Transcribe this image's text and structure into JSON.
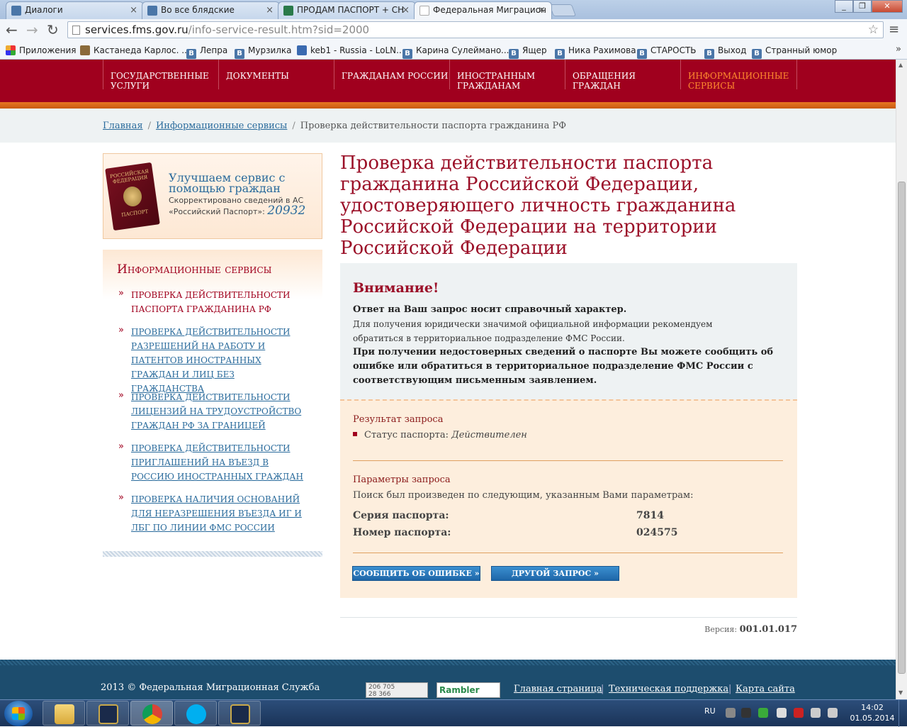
{
  "tabs": [
    {
      "label": "Диалоги",
      "color": "#4a76a8"
    },
    {
      "label": "Во все блядские",
      "color": "#4a76a8"
    },
    {
      "label": "ПРОДАМ ПАСПОРТ + СН",
      "color": "#2a7a4a"
    },
    {
      "label": "Федеральная Миграцион",
      "color": "#ffffff"
    }
  ],
  "address": {
    "host": "services.fms.gov.ru",
    "path": "/info-service-result.htm?sid=2000"
  },
  "bookmarks": [
    "Приложения",
    "Кастанеда Карлос. ...",
    "Лепра",
    "Мурзилка",
    "keb1 - Russia - LoLN...",
    "Карина Сулейманo...",
    "Ящер",
    "Ника Рахимова",
    "СТАРОСТЬ",
    "Выход",
    "Странный юмор"
  ],
  "nav": [
    {
      "label": "ГОСУДАРСТВЕННЫЕ\nУСЛУГИ"
    },
    {
      "label": "ДОКУМЕНТЫ"
    },
    {
      "label": "ГРАЖДАНАМ РОССИИ"
    },
    {
      "label": "ИНОСТРАННЫМ\nГРАЖДАНАМ"
    },
    {
      "label": "ОБРАЩЕНИЯ\nГРАЖДАН"
    },
    {
      "label": "ИНФОРМАЦИОННЫЕ\nСЕРВИСЫ"
    }
  ],
  "breadcrumbs": {
    "home": "Главная",
    "section": "Информационные сервисы",
    "current": "Проверка действительности паспорта гражданина РФ"
  },
  "promo": {
    "title": "Улучшаем сервис с помощью граждан",
    "text": "Скорректировано сведений в АС «Российский Паспорт»:",
    "count": "20932",
    "passport_top": "РОССИЙСКАЯ ФЕДЕРАЦИЯ",
    "passport_label": "ПАСПОРТ"
  },
  "sidebar": {
    "title": "Информационные сервисы",
    "items": [
      "Проверка действительности паспорта гражданина РФ",
      "Проверка действительности разрешений на работу и патентов иностранных граждан и лиц без гражданства",
      "Проверка действительности лицензий на трудоустройство граждан РФ за границей",
      "Проверка действительности приглашений на въезд в Россию иностранных граждан",
      "Проверка наличия оснований для неразрешения въезда ИГ и ЛБГ по линии ФМС России"
    ]
  },
  "page_title": "Проверка действительности паспорта гражданина Российской Федерации, удостоверяющего личность гражданина Российской Федерации на территории Российской Федерации",
  "attention": {
    "heading": "Внимание!",
    "p1": "Ответ на Ваш запрос носит справочный характер.",
    "p2": "Для получения юридически значимой официальной информации рекомендуем обратиться в территориальное подразделение ФМС России.",
    "p3": "При получении недостоверных сведений о паспорте Вы можете сообщить об ошибке или обратиться в территориальное подразделение ФМС России с соответствующим письменным заявлением."
  },
  "result": {
    "heading": "Результат запроса",
    "status_label": "Статус паспорта:",
    "status_value": "Действителен",
    "params_heading": "Параметры запроса",
    "params_note": "Поиск был произведен по следующим, указанным Вами параметрам:",
    "series_label": "Серия паспорта:",
    "series_value": "7814",
    "number_label": "Номер паспорта:",
    "number_value": "024575",
    "report_button": "Сообщить об ошибке »",
    "another_button": "Другой запрос »"
  },
  "version": {
    "label": "Версия:",
    "value": "001.01.017"
  },
  "footer": {
    "copyright": "2013 © Федеральная Миграционная Служба",
    "counter_text": "206 705\n28 366",
    "rambler": "Rambler",
    "links": [
      "Главная страница",
      "Техническая поддержка",
      "Карта сайта"
    ]
  },
  "taskbar": {
    "lang": "RU",
    "time": "14:02",
    "date": "01.05.2014"
  }
}
